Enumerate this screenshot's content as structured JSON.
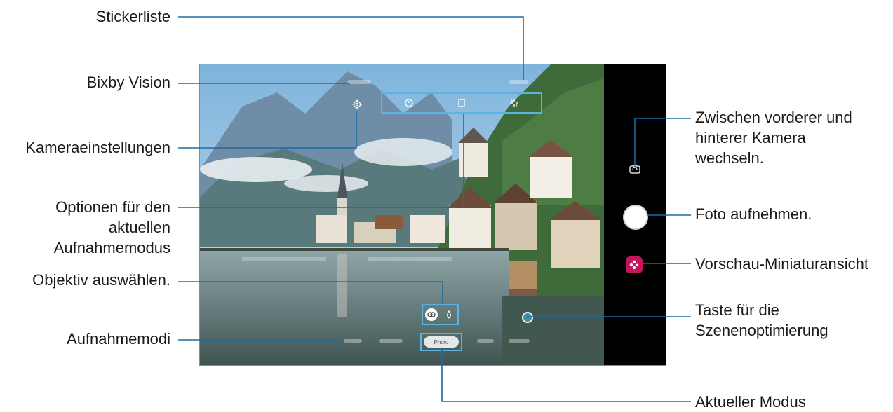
{
  "labels": {
    "sticker_list": "Stickerliste",
    "bixby_vision": "Bixby Vision",
    "camera_settings": "Kameraeinstellungen",
    "current_mode_options": [
      "Optionen für den",
      "aktuellen",
      "Aufnahmemodus"
    ],
    "select_lens": "Objektiv auswählen.",
    "shooting_modes": "Aufnahmemodi",
    "switch_camera": [
      "Zwischen vorderer und",
      "hinterer Kamera",
      "wechseln."
    ],
    "take_photo": "Foto aufnehmen.",
    "preview_thumbnail": "Vorschau-Miniaturansicht",
    "scene_optimizer": [
      "Taste für die",
      "Szenenoptimierung"
    ],
    "current_mode": "Aktueller Modus"
  },
  "camera_ui": {
    "current_mode_value": "Photo",
    "icons": [
      "settings-gear-icon",
      "timer-off-icon",
      "aspect-ratio-icon",
      "filter-sparkle-icon",
      "switch-camera-icon",
      "gallery-thumbnail-icon",
      "lens-wide-icon",
      "lens-standard-icon"
    ]
  },
  "colors": {
    "callout_line": "#1e6aa0",
    "highlight_box": "#5ab4e3",
    "thumbnail": "#c2185b"
  }
}
